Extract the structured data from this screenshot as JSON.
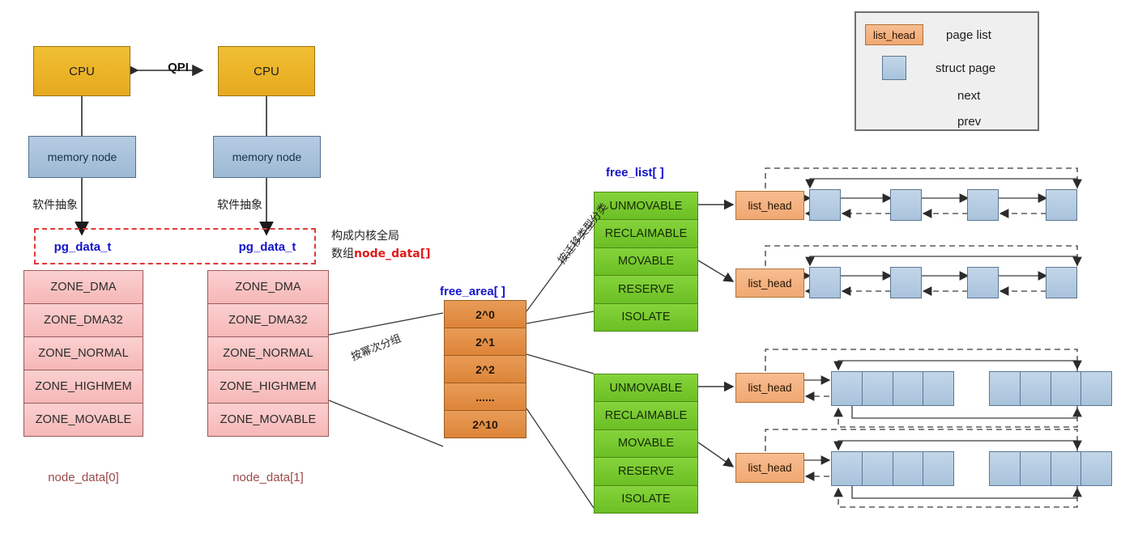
{
  "diagram": {
    "title_semantic": "linux-kernel-memory-zone-buddy-allocator-diagram",
    "colors": {
      "cpu": "#e7a91f",
      "memory_node": "#9dbad4",
      "zone": "#f6b7b7",
      "free_area": "#dd8438",
      "free_list": "#6bbf25",
      "list_head": "#f0a872",
      "struct_page": "#a9c3dc",
      "pgdata_dashed_border": "#e03a3a",
      "struct_title_text": "#1414cd",
      "node_label_text": "#9c4a4a",
      "highlight_red_text": "#e01b1b"
    }
  },
  "cpus": [
    {
      "label": "CPU"
    },
    {
      "label": "CPU"
    }
  ],
  "interconnect": {
    "label": "QPI"
  },
  "memory_nodes": [
    {
      "label": "memory node"
    },
    {
      "label": "memory node"
    }
  ],
  "abstraction_labels": [
    {
      "text": "软件抽象"
    },
    {
      "text": "软件抽象"
    }
  ],
  "pg_data": {
    "boxes": [
      {
        "label": "pg_data_t"
      },
      {
        "label": "pg_data_t"
      }
    ],
    "note_line1": "构成内核全局",
    "note_line2_prefix": "数组",
    "note_line2_highlight": "node_data[]"
  },
  "zones": {
    "cells": [
      "ZONE_DMA",
      "ZONE_DMA32",
      "ZONE_NORMAL",
      "ZONE_HIGHMEM",
      "ZONE_MOVABLE"
    ],
    "columns": [
      {
        "caption": "node_data[0]"
      },
      {
        "caption": "node_data[1]"
      }
    ]
  },
  "free_area": {
    "title": "free_area[ ]",
    "cells": [
      "2^0",
      "2^1",
      "2^2",
      "......",
      "2^10"
    ],
    "edge_label": "按幂次分组"
  },
  "free_list": {
    "title": "free_list[ ]",
    "cells": [
      "UNMOVABLE",
      "RECLAIMABLE",
      "MOVABLE",
      "RESERVE",
      "ISOLATE"
    ],
    "edge_label": "按迁移类型分类",
    "groups": [
      {
        "name": "order-0-free-list",
        "cells": [
          "UNMOVABLE",
          "RECLAIMABLE",
          "MOVABLE",
          "RESERVE",
          "ISOLATE"
        ]
      },
      {
        "name": "order-2-free-list",
        "cells": [
          "UNMOVABLE",
          "RECLAIMABLE",
          "MOVABLE",
          "RESERVE",
          "ISOLATE"
        ]
      }
    ]
  },
  "page_lists": {
    "list_head_label": "list_head",
    "single_page_lists": [
      {
        "head": "list_head",
        "page_count": 4
      },
      {
        "head": "list_head",
        "page_count": 4
      }
    ],
    "grouped_page_lists": [
      {
        "head": "list_head",
        "groups": 2,
        "pages_per_group": 4
      },
      {
        "head": "list_head",
        "groups": 2,
        "pages_per_group": 4
      }
    ]
  },
  "legend": {
    "rows": [
      {
        "swatch": "list_head",
        "label": "page list"
      },
      {
        "swatch": "page",
        "label": "struct page"
      },
      {
        "swatch": "solid-arrow",
        "label": "next"
      },
      {
        "swatch": "dashed-arrow",
        "label": "prev"
      }
    ]
  }
}
